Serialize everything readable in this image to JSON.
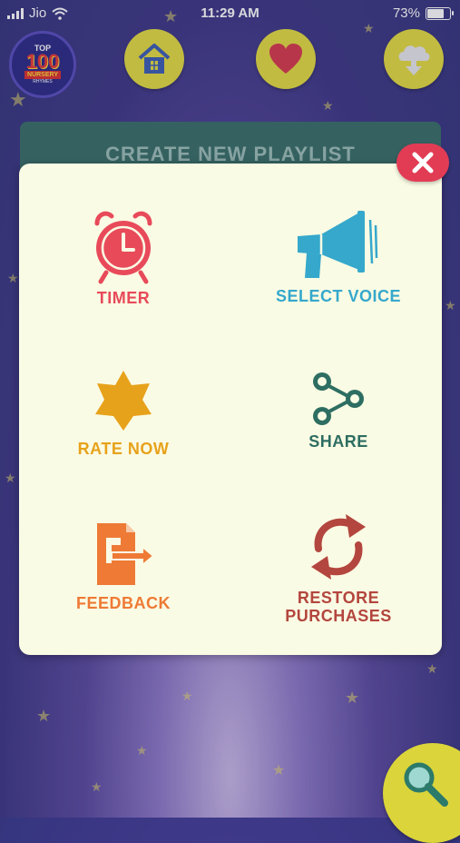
{
  "status_bar": {
    "carrier": "Jio",
    "time": "11:29 AM",
    "battery": "73%"
  },
  "nav": {
    "logo": {
      "top": "TOP",
      "number": "100",
      "sub": "NURSERY",
      "sub2": "RHYMES"
    },
    "icons": [
      "home-icon",
      "heart-icon",
      "download-icon"
    ]
  },
  "playlist_bar": {
    "label": "CREATE NEW PLAYLIST"
  },
  "menu": {
    "items": [
      {
        "label": "TIMER",
        "icon": "alarm-clock-icon",
        "color": "#e84a5a"
      },
      {
        "label": "SELECT VOICE",
        "icon": "megaphone-icon",
        "color": "#35a8cc"
      },
      {
        "label": "RATE NOW",
        "icon": "star-icon",
        "color": "#e7a21b"
      },
      {
        "label": "SHARE",
        "icon": "share-icon",
        "color": "#2e6e62"
      },
      {
        "label": "FEEDBACK",
        "icon": "feedback-icon",
        "color": "#ee7a35"
      },
      {
        "label_line1": "RESTORE",
        "label_line2": "PURCHASES",
        "icon": "restore-icon",
        "color": "#b3463e"
      }
    ]
  },
  "colors": {
    "nav_button": "#e3dc43",
    "modal_bg": "#fafbe4",
    "close_button": "#e23c55",
    "playlist_bar": "#39706a"
  }
}
